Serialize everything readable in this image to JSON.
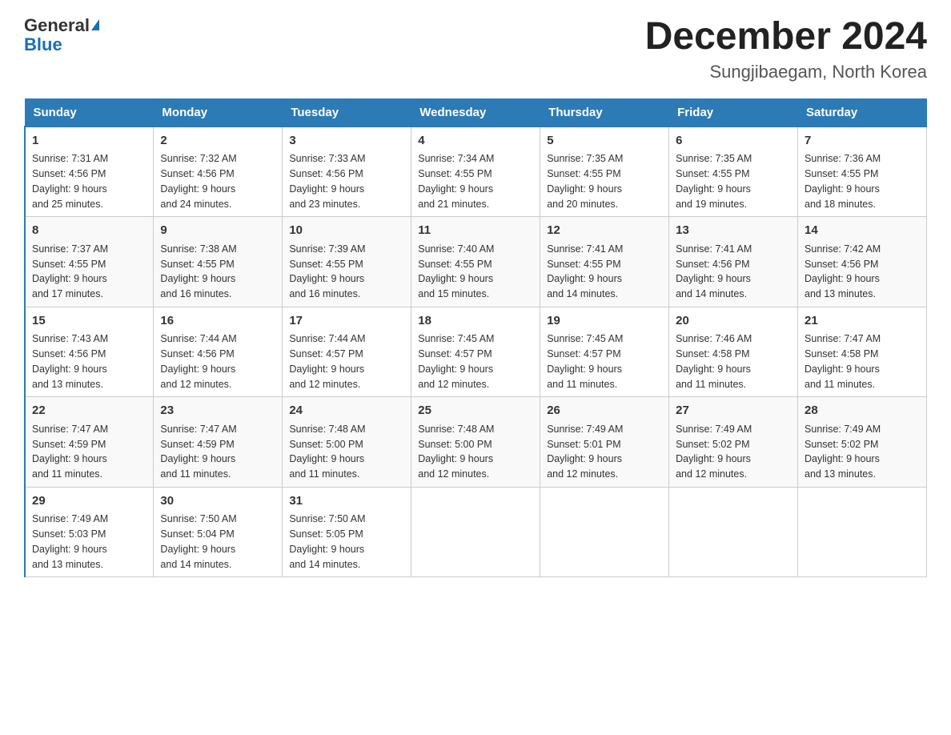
{
  "header": {
    "logo_general": "General",
    "logo_blue": "Blue",
    "month_title": "December 2024",
    "location": "Sungjibaegam, North Korea"
  },
  "columns": [
    "Sunday",
    "Monday",
    "Tuesday",
    "Wednesday",
    "Thursday",
    "Friday",
    "Saturday"
  ],
  "weeks": [
    [
      {
        "day": "1",
        "info": "Sunrise: 7:31 AM\nSunset: 4:56 PM\nDaylight: 9 hours\nand 25 minutes."
      },
      {
        "day": "2",
        "info": "Sunrise: 7:32 AM\nSunset: 4:56 PM\nDaylight: 9 hours\nand 24 minutes."
      },
      {
        "day": "3",
        "info": "Sunrise: 7:33 AM\nSunset: 4:56 PM\nDaylight: 9 hours\nand 23 minutes."
      },
      {
        "day": "4",
        "info": "Sunrise: 7:34 AM\nSunset: 4:55 PM\nDaylight: 9 hours\nand 21 minutes."
      },
      {
        "day": "5",
        "info": "Sunrise: 7:35 AM\nSunset: 4:55 PM\nDaylight: 9 hours\nand 20 minutes."
      },
      {
        "day": "6",
        "info": "Sunrise: 7:35 AM\nSunset: 4:55 PM\nDaylight: 9 hours\nand 19 minutes."
      },
      {
        "day": "7",
        "info": "Sunrise: 7:36 AM\nSunset: 4:55 PM\nDaylight: 9 hours\nand 18 minutes."
      }
    ],
    [
      {
        "day": "8",
        "info": "Sunrise: 7:37 AM\nSunset: 4:55 PM\nDaylight: 9 hours\nand 17 minutes."
      },
      {
        "day": "9",
        "info": "Sunrise: 7:38 AM\nSunset: 4:55 PM\nDaylight: 9 hours\nand 16 minutes."
      },
      {
        "day": "10",
        "info": "Sunrise: 7:39 AM\nSunset: 4:55 PM\nDaylight: 9 hours\nand 16 minutes."
      },
      {
        "day": "11",
        "info": "Sunrise: 7:40 AM\nSunset: 4:55 PM\nDaylight: 9 hours\nand 15 minutes."
      },
      {
        "day": "12",
        "info": "Sunrise: 7:41 AM\nSunset: 4:55 PM\nDaylight: 9 hours\nand 14 minutes."
      },
      {
        "day": "13",
        "info": "Sunrise: 7:41 AM\nSunset: 4:56 PM\nDaylight: 9 hours\nand 14 minutes."
      },
      {
        "day": "14",
        "info": "Sunrise: 7:42 AM\nSunset: 4:56 PM\nDaylight: 9 hours\nand 13 minutes."
      }
    ],
    [
      {
        "day": "15",
        "info": "Sunrise: 7:43 AM\nSunset: 4:56 PM\nDaylight: 9 hours\nand 13 minutes."
      },
      {
        "day": "16",
        "info": "Sunrise: 7:44 AM\nSunset: 4:56 PM\nDaylight: 9 hours\nand 12 minutes."
      },
      {
        "day": "17",
        "info": "Sunrise: 7:44 AM\nSunset: 4:57 PM\nDaylight: 9 hours\nand 12 minutes."
      },
      {
        "day": "18",
        "info": "Sunrise: 7:45 AM\nSunset: 4:57 PM\nDaylight: 9 hours\nand 12 minutes."
      },
      {
        "day": "19",
        "info": "Sunrise: 7:45 AM\nSunset: 4:57 PM\nDaylight: 9 hours\nand 11 minutes."
      },
      {
        "day": "20",
        "info": "Sunrise: 7:46 AM\nSunset: 4:58 PM\nDaylight: 9 hours\nand 11 minutes."
      },
      {
        "day": "21",
        "info": "Sunrise: 7:47 AM\nSunset: 4:58 PM\nDaylight: 9 hours\nand 11 minutes."
      }
    ],
    [
      {
        "day": "22",
        "info": "Sunrise: 7:47 AM\nSunset: 4:59 PM\nDaylight: 9 hours\nand 11 minutes."
      },
      {
        "day": "23",
        "info": "Sunrise: 7:47 AM\nSunset: 4:59 PM\nDaylight: 9 hours\nand 11 minutes."
      },
      {
        "day": "24",
        "info": "Sunrise: 7:48 AM\nSunset: 5:00 PM\nDaylight: 9 hours\nand 11 minutes."
      },
      {
        "day": "25",
        "info": "Sunrise: 7:48 AM\nSunset: 5:00 PM\nDaylight: 9 hours\nand 12 minutes."
      },
      {
        "day": "26",
        "info": "Sunrise: 7:49 AM\nSunset: 5:01 PM\nDaylight: 9 hours\nand 12 minutes."
      },
      {
        "day": "27",
        "info": "Sunrise: 7:49 AM\nSunset: 5:02 PM\nDaylight: 9 hours\nand 12 minutes."
      },
      {
        "day": "28",
        "info": "Sunrise: 7:49 AM\nSunset: 5:02 PM\nDaylight: 9 hours\nand 13 minutes."
      }
    ],
    [
      {
        "day": "29",
        "info": "Sunrise: 7:49 AM\nSunset: 5:03 PM\nDaylight: 9 hours\nand 13 minutes."
      },
      {
        "day": "30",
        "info": "Sunrise: 7:50 AM\nSunset: 5:04 PM\nDaylight: 9 hours\nand 14 minutes."
      },
      {
        "day": "31",
        "info": "Sunrise: 7:50 AM\nSunset: 5:05 PM\nDaylight: 9 hours\nand 14 minutes."
      },
      {
        "day": "",
        "info": ""
      },
      {
        "day": "",
        "info": ""
      },
      {
        "day": "",
        "info": ""
      },
      {
        "day": "",
        "info": ""
      }
    ]
  ]
}
